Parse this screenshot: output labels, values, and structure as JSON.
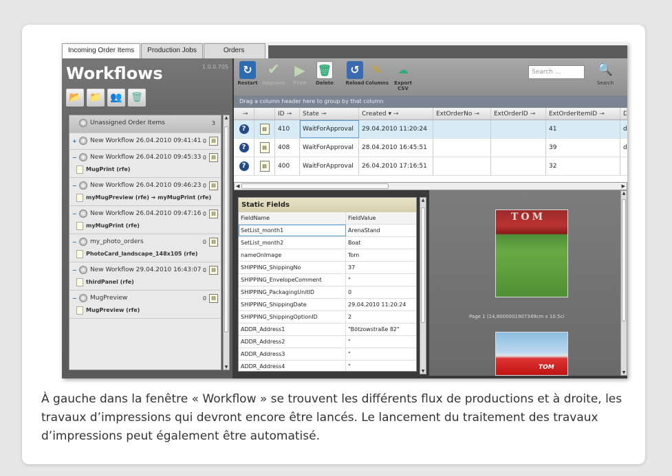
{
  "tabs": [
    "Incoming Order Items",
    "Production Jobs",
    "Orders"
  ],
  "left": {
    "title": "Workflows",
    "version": "1.0.0.705",
    "tool_icons": [
      "folder-open-icon",
      "folder-icon",
      "users-icon",
      "trash-icon"
    ],
    "workflows": [
      {
        "name": "Unassigned Order Items",
        "count": "3",
        "toggle": "",
        "jobs": []
      },
      {
        "name": "New Workflow 26.04.2010 09:41:41",
        "count": "0",
        "toggle": "+",
        "jobs": []
      },
      {
        "name": "New Workflow 26.04.2010 09:45:33",
        "count": "0",
        "toggle": "−",
        "jobs": [
          "MugPrint (rfe)"
        ]
      },
      {
        "name": "New Workflow 26.04.2010 09:46:23",
        "count": "0",
        "toggle": "−",
        "jobs": [
          "myMugPreview (rfe) ➔ myMugPrint (rfe)"
        ]
      },
      {
        "name": "New Workflow 26.04.2010 09:47:16",
        "count": "0",
        "toggle": "−",
        "jobs": [
          "myMugPrint (rfe)"
        ]
      },
      {
        "name": "my_photo_orders",
        "count": "0",
        "toggle": "−",
        "jobs": [
          "PhotoCard_landscape_148x105 (rfe)"
        ]
      },
      {
        "name": "New Workflow 29.04.2010 16:43:07",
        "count": "0",
        "toggle": "−",
        "jobs": [
          "thirdPanel (rfe)"
        ]
      },
      {
        "name": "MugPreview",
        "count": "0",
        "toggle": "−",
        "jobs": [
          "MugPreview (rfe)"
        ]
      }
    ]
  },
  "toolbar": {
    "restart": "Restart",
    "approve": "Approve",
    "print": "Print",
    "delete": "Delete",
    "reload": "Reload",
    "columns": "Columns",
    "export": "Export CSV",
    "search_placeholder": "Search ...",
    "search": "Search"
  },
  "groupbar": "Drag a column header here to group by that column",
  "grid": {
    "headers": [
      "",
      "",
      "ID",
      "State",
      "Created",
      "ExtOrderNo",
      "ExtOrderID",
      "ExtOrderItemID",
      "D"
    ],
    "rows": [
      {
        "id": "410",
        "state": "WaitForApproval",
        "created": "29.04.2010 11:20:24",
        "ext_item": "41",
        "d": "d"
      },
      {
        "id": "408",
        "state": "WaitForApproval",
        "created": "28.04.2010 16:45:51",
        "ext_item": "39",
        "d": "d"
      },
      {
        "id": "400",
        "state": "WaitForApproval",
        "created": "26.04.2010 17:16:51",
        "ext_item": "32",
        "d": ""
      }
    ]
  },
  "static_fields": {
    "title": "Static Fields",
    "col_name": "FieldName",
    "col_value": "FieldValue",
    "rows": [
      [
        "SetList_month1",
        "ArenaStand"
      ],
      [
        "SetList_month2",
        "Boat"
      ],
      [
        "nameOnImage",
        "Tom"
      ],
      [
        "SHIPPING_ShippingNo",
        "37"
      ],
      [
        "SHIPPING_EnvelopeComment",
        "\""
      ],
      [
        "SHIPPING_PackagingUnitID",
        "0"
      ],
      [
        "SHIPPING_ShippingDate",
        "29.04.2010 11:20:24"
      ],
      [
        "SHIPPING_ShippingOptionID",
        "2"
      ],
      [
        "ADDR_Address1",
        "\"Bötzowstraße 82\""
      ],
      [
        "ADDR_Address2",
        "\""
      ],
      [
        "ADDR_Address3",
        "\""
      ],
      [
        "ADDR_Address4",
        "\""
      ]
    ]
  },
  "preview": {
    "img1_text": "TOM",
    "caption": "Page 1 (14,8000001907349cm x 10.5ci",
    "img2_text": "TOM"
  },
  "caption": "À gauche dans la fenêtre « Workflow » se trouvent les différents flux de productions et à droite, les travaux d’impressions qui devront encore être lancés. Le lancement du traitement des travaux d’impressions peut également être automatisé."
}
